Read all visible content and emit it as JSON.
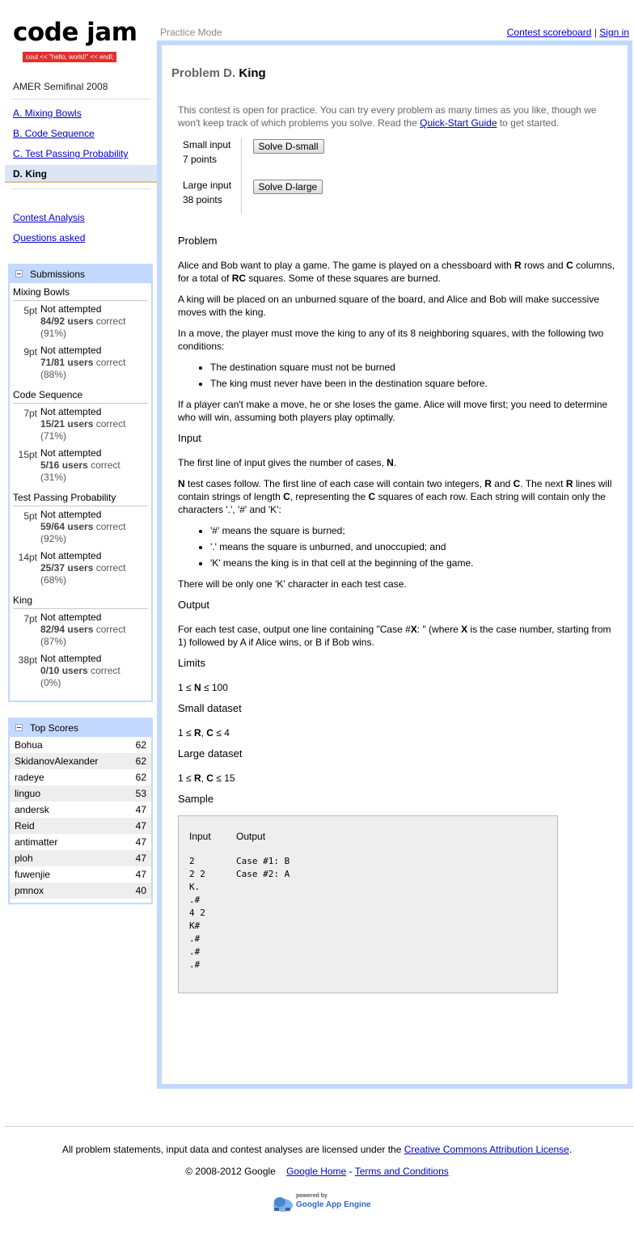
{
  "logo": {
    "title": "code jam",
    "tagline": "cout << \"hello, world!\" << endl;"
  },
  "contest_name": "AMER Semifinal 2008",
  "nav": {
    "problems": [
      "A. Mixing Bowls",
      "B. Code Sequence",
      "C. Test Passing Probability"
    ],
    "active": "D. King",
    "contest_analysis": "Contest Analysis",
    "questions_asked": "Questions asked"
  },
  "submissions": {
    "title": "Submissions",
    "problems": [
      {
        "name": "Mixing Bowls",
        "rows": [
          {
            "pts": "5pt",
            "status": "Not attempted",
            "ratio": "84/92 users",
            "suffix": "correct",
            "pct": "(91%)"
          },
          {
            "pts": "9pt",
            "status": "Not attempted",
            "ratio": "71/81 users",
            "suffix": "correct",
            "pct": "(88%)"
          }
        ]
      },
      {
        "name": "Code Sequence",
        "rows": [
          {
            "pts": "7pt",
            "status": "Not attempted",
            "ratio": "15/21 users",
            "suffix": "correct",
            "pct": "(71%)"
          },
          {
            "pts": "15pt",
            "status": "Not attempted",
            "ratio": "5/16 users",
            "suffix": "correct",
            "pct": "(31%)"
          }
        ]
      },
      {
        "name": "Test Passing Probability",
        "rows": [
          {
            "pts": "5pt",
            "status": "Not attempted",
            "ratio": "59/64 users",
            "suffix": "correct",
            "pct": "(92%)"
          },
          {
            "pts": "14pt",
            "status": "Not attempted",
            "ratio": "25/37 users",
            "suffix": "correct",
            "pct": "(68%)"
          }
        ]
      },
      {
        "name": "King",
        "rows": [
          {
            "pts": "7pt",
            "status": "Not attempted",
            "ratio": "82/94 users",
            "suffix": "correct",
            "pct": "(87%)"
          },
          {
            "pts": "38pt",
            "status": "Not attempted",
            "ratio": "0/10 users",
            "suffix": "correct",
            "pct": "(0%)"
          }
        ]
      }
    ]
  },
  "top_scores": {
    "title": "Top Scores",
    "rows": [
      {
        "name": "Bohua",
        "score": "62"
      },
      {
        "name": "SkidanovAlexander",
        "score": "62"
      },
      {
        "name": "radeye",
        "score": "62"
      },
      {
        "name": "linguo",
        "score": "53"
      },
      {
        "name": "andersk",
        "score": "47"
      },
      {
        "name": "Reid",
        "score": "47"
      },
      {
        "name": "antimatter",
        "score": "47"
      },
      {
        "name": "ploh",
        "score": "47"
      },
      {
        "name": "fuwenjie",
        "score": "47"
      },
      {
        "name": "pmnox",
        "score": "40"
      }
    ]
  },
  "header": {
    "mode": "Practice Mode",
    "scoreboard_link": "Contest scoreboard",
    "separator": "|",
    "signin_link": "Sign in"
  },
  "problem": {
    "label": "Problem D.",
    "name": "King",
    "notice_text": "This contest is open for practice. You can try every problem as many times as you like, though we won't keep track of which problems you solve. Read the",
    "notice_link": "Quick-Start Guide",
    "notice_end": "to get started.",
    "small_input": {
      "label": "Small input",
      "points": "7 points",
      "button": "Solve D-small"
    },
    "large_input": {
      "label": "Large input",
      "points": "38 points",
      "button": "Solve D-large"
    },
    "sections": {
      "problem": "Problem",
      "input": "Input",
      "output": "Output",
      "limits": "Limits",
      "small_dataset": "Small dataset",
      "large_dataset": "Large dataset",
      "sample": "Sample"
    },
    "p1": {
      "a": "Alice and Bob want to play a game. The game is played on a chessboard with ",
      "b": "R",
      "c": " rows and ",
      "d": "C",
      "e": " columns, for a total of ",
      "f": "RC",
      "g": " squares. Some of these squares are burned."
    },
    "p2": "A king will be placed on an unburned square of the board, and Alice and Bob will make successive moves with the king.",
    "p3": "In a move, the player must move the king to any of its 8 neighboring squares, with the following two conditions:",
    "conditions": [
      "The destination square must not be burned",
      "The king must never have been in the destination square before."
    ],
    "p4": "If a player can't make a move, he or she loses the game. Alice will move first; you need to determine who will win, assuming both players play optimally.",
    "input_p1": {
      "a": "The first line of input gives the number of cases, ",
      "b": "N",
      "c": "."
    },
    "input_p2": {
      "a": "N",
      "b": " test cases follow. The first line of each case will contain two integers, ",
      "c": "R",
      "d": " and ",
      "e": "C",
      "f": ". The next ",
      "g": "R",
      "h": " lines will contain strings of length ",
      "i": "C",
      "j": ", representing the ",
      "k": "C",
      "l": " squares of each row. Each string will contain only the characters '.', '#' and 'K':"
    },
    "chars": [
      "'#' means the square is burned;",
      "'.' means the square is unburned, and unoccupied; and",
      "'K' means the king is in that cell at the beginning of the game."
    ],
    "input_p3": "There will be only one 'K' character in each test case.",
    "output_p": {
      "a": "For each test case, output one line containing \"Case #",
      "b": "X",
      "c": ": \" (where ",
      "d": "X",
      "e": " is the case number, starting from 1) followed by A if Alice wins, or B if Bob wins."
    },
    "limits": {
      "a": "1 ≤ ",
      "b": "N",
      "c": " ≤ 100"
    },
    "small_ds": {
      "a": "1 ≤ ",
      "b": "R",
      "c": ", ",
      "d": "C",
      "e": " ≤ 4"
    },
    "large_ds": {
      "a": "1 ≤ ",
      "b": "R",
      "c": ", ",
      "d": "C",
      "e": " ≤ 15"
    },
    "sample": {
      "input_header": "Input",
      "output_header": "Output",
      "input": "2\n2 2\nK.\n.#\n4 2\nK#\n.#\n.#\n.#",
      "output": "Case #1: B\nCase #2: A"
    }
  },
  "footer": {
    "license_text": "All problem statements, input data and contest analyses are licensed under the",
    "license_link": "Creative Commons Attribution License",
    "license_end": ".",
    "copyright": "© 2008-2012 Google",
    "google_home": "Google Home",
    "dash": "-",
    "terms": "Terms and Conditions",
    "powered_by": "powered by",
    "app_engine": "Google App Engine"
  },
  "colors": {
    "accent_blue": "#c3d9ff",
    "logo_red": "#e03030",
    "link": "#0000cc"
  }
}
